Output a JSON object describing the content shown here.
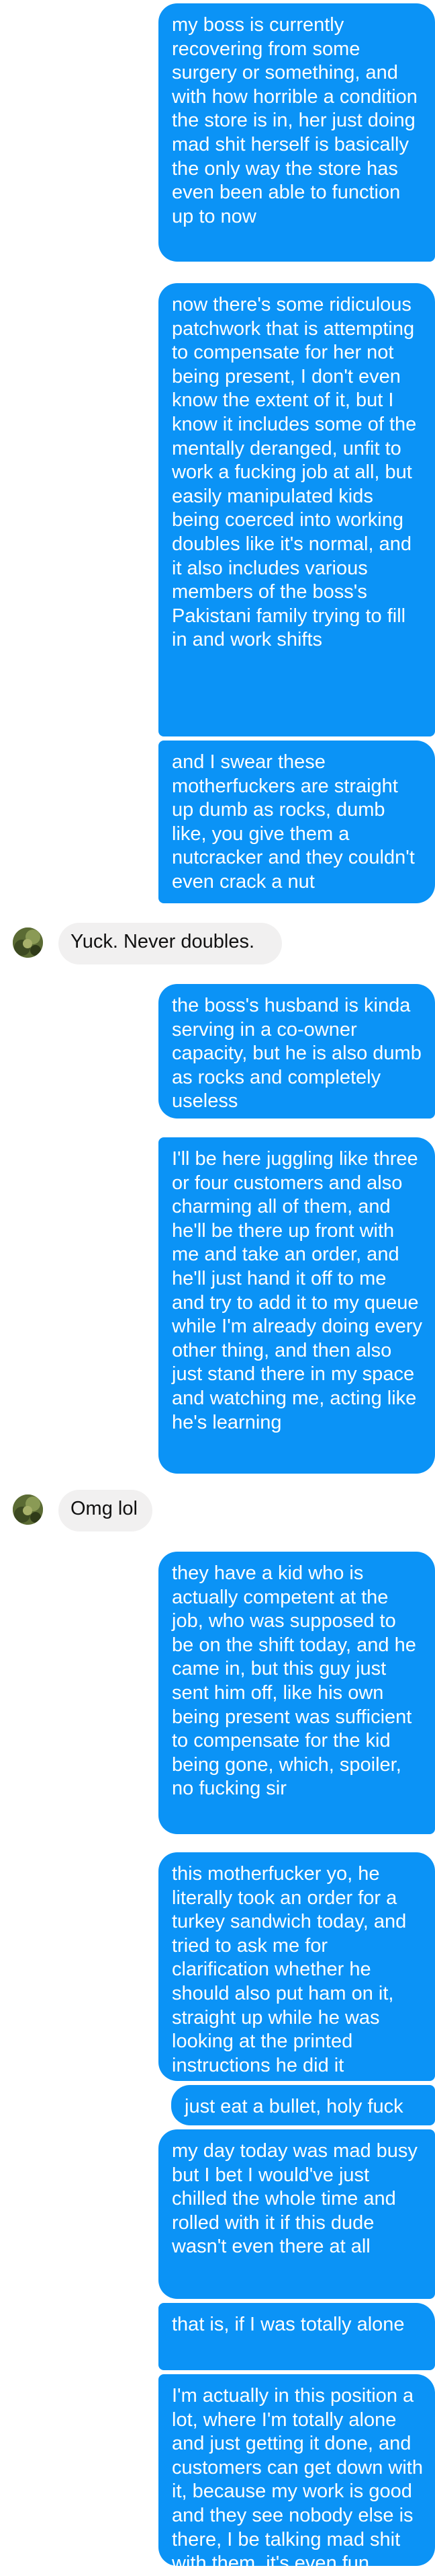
{
  "messages": [
    {
      "sender": "me",
      "text": "my boss is currently recovering from some surgery or something, and with how horrible a condition the store is in, her just doing mad shit herself is basically the only way the store has even been able to function up to now"
    },
    {
      "sender": "me",
      "text": "now there's some ridiculous patchwork that is attempting to compensate for her not being present, I don't even know the extent of it, but I know it includes some of the mentally deranged, unfit to work a fucking job at all, but easily manipulated kids being coerced into working doubles like it's normal, and it also includes various members of the boss's Pakistani family trying to fill in and work shifts"
    },
    {
      "sender": "me",
      "text": "and I swear these motherfuckers are straight up dumb as rocks, dumb like, you give them a nutcracker and they couldn't even crack a nut"
    },
    {
      "sender": "them",
      "text": "Yuck. Never doubles."
    },
    {
      "sender": "me",
      "text": "the boss's husband is kinda serving in a co-owner capacity, but he is also dumb as rocks and completely useless"
    },
    {
      "sender": "me",
      "text": "I'll be here juggling like three or four customers and also charming all of them, and he'll be there up front with me and take an order, and he'll just hand it off to me and try to add it to my queue while I'm already doing every other thing, and then also just stand there in my space and watching me, acting like he's learning"
    },
    {
      "sender": "them",
      "text": "Omg lol"
    },
    {
      "sender": "me",
      "text": "they have a kid who is actually competent at the job, who was supposed to be on the shift today, and he came in, but this guy just sent him off, like his own being present was sufficient to compensate for the kid being gone, which, spoiler, no fucking sir"
    },
    {
      "sender": "me",
      "text": "this motherfucker yo, he literally took an order for a turkey sandwich today, and tried to ask me for clarification whether he should also put ham on it, straight up while he was looking at the printed instructions he did it"
    },
    {
      "sender": "me",
      "text": "just eat a bullet, holy fuck"
    },
    {
      "sender": "me",
      "text": "my day today was mad busy but I bet I would've just chilled the whole time and rolled with it if this dude wasn't even there at all"
    },
    {
      "sender": "me",
      "text": "that is, if I was totally alone"
    },
    {
      "sender": "me",
      "text": "I'm actually in this position a lot, where I'm totally alone and just getting it done, and customers can get down with it, because my work is good and they see nobody else is there, I be talking mad shit with them, it's even fun"
    }
  ],
  "colors": {
    "outgoing_bubble": "#0b93f6",
    "outgoing_text": "#ffffff",
    "incoming_bubble": "#f1f0f0",
    "incoming_text": "#111111"
  },
  "avatar_icon": "contact-avatar-photo"
}
